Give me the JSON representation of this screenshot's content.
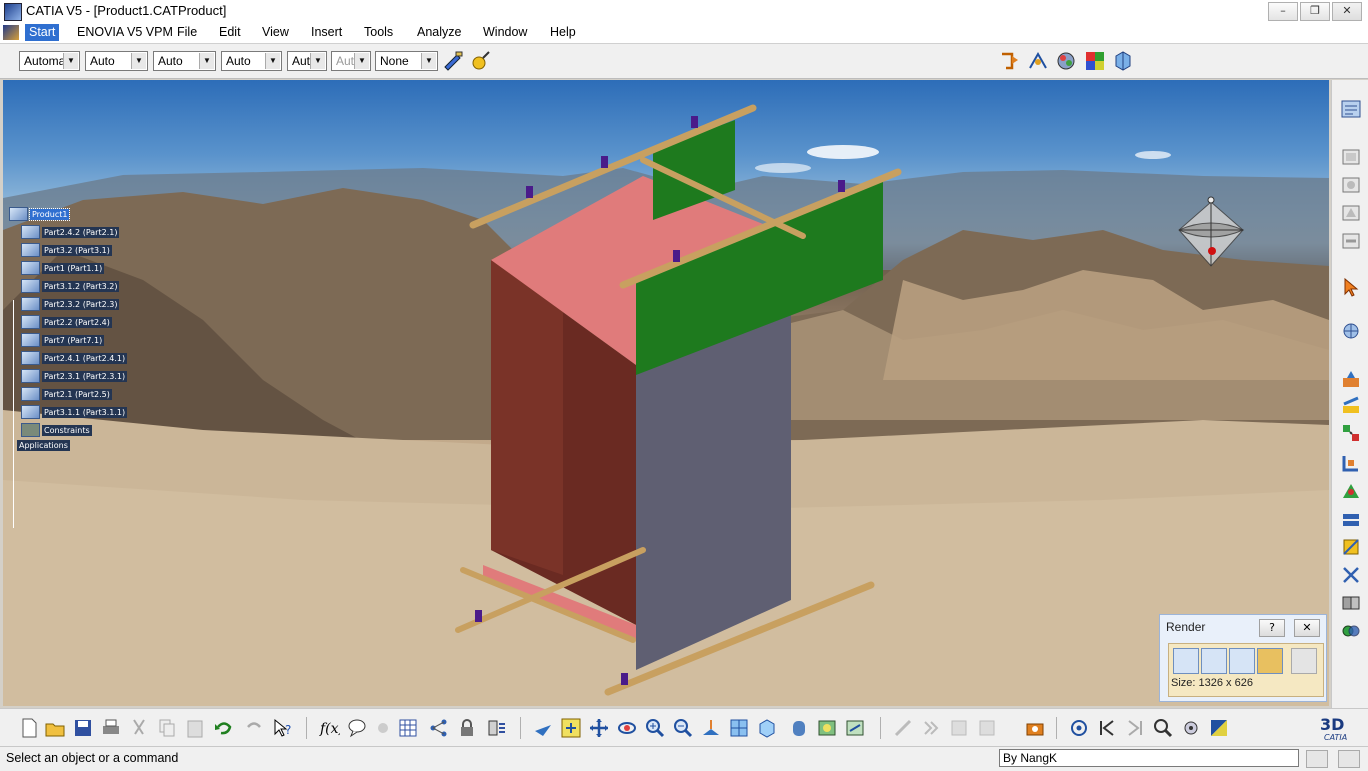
{
  "window": {
    "title": "CATIA V5 - [Product1.CATProduct]",
    "minimize": "–",
    "restore": "❐",
    "close": "✕"
  },
  "menu": {
    "items": [
      "Start",
      "ENOVIA V5 VPM",
      "File",
      "Edit",
      "View",
      "Insert",
      "Tools",
      "Analyze",
      "Window",
      "Help"
    ],
    "doc_minimize": "–",
    "doc_restore": "❐",
    "doc_close": "✕"
  },
  "toolbar": {
    "combos": [
      {
        "value": "Automa"
      },
      {
        "value": "Auto"
      },
      {
        "value": "Auto"
      },
      {
        "value": "Auto"
      },
      {
        "value": "Aut"
      },
      {
        "value": "Aut"
      },
      {
        "value": "None"
      }
    ],
    "combo_arrow": "▼"
  },
  "tree": {
    "root": "Product1",
    "nodes": [
      "Part2.4.2 (Part2.1)",
      "Part3.2 (Part3.1)",
      "Part1 (Part1.1)",
      "Part3.1.2 (Part3.2)",
      "Part2.3.2 (Part2.3)",
      "Part2.2 (Part2.4)",
      "Part7 (Part7.1)",
      "Part2.4.1 (Part2.4.1)",
      "Part2.3.1 (Part2.3.1)",
      "Part2.1 (Part2.5)",
      "Part3.1.1 (Part3.1.1)"
    ],
    "constraints": "Constraints",
    "applications": "Applications",
    "expander": "+"
  },
  "render_panel": {
    "title": "Render",
    "help": "?",
    "close": "✕",
    "size_text": "Size: 1326 x 626"
  },
  "status": {
    "message": "Select an object or a command",
    "command_input": "By NangK"
  },
  "icons": {
    "top_right": [
      "update-icon",
      "fly-mode-icon",
      "apply-material-icon",
      "scenes-icon",
      "catalog-icon"
    ],
    "right": [
      "tree-icon",
      "product-icon",
      "component-icon",
      "part-icon",
      "existing-component-icon",
      "select-icon",
      "manipulate-icon",
      "fix-icon",
      "snap-icon",
      "explode-icon",
      "constraint-icon",
      "coincidence-icon",
      "contact-icon",
      "offset-icon",
      "angle-icon",
      "fix-together-icon",
      "quick-constraint-icon"
    ],
    "bottom": [
      "new-icon",
      "open-icon",
      "save-icon",
      "print-icon",
      "cut-icon",
      "copy-icon",
      "paste-icon",
      "undo-icon",
      "redo-icon",
      "whats-this-icon",
      "formula-icon",
      "annotation-icon",
      "knowledge-icon",
      "table-icon",
      "graph-icon",
      "lock-icon",
      "measure-icon",
      "fly-icon",
      "fit-all-icon",
      "pan-icon",
      "rotate-icon",
      "zoom-in-icon",
      "zoom-out-icon",
      "normal-view-icon",
      "multi-view-icon",
      "isometric-icon",
      "shading-icon",
      "hide-show-icon",
      "swap-icon",
      "camera-icon",
      "target-icon",
      "first-icon",
      "next-icon",
      "search-icon",
      "settings-icon",
      "color-icon"
    ]
  },
  "colors": {
    "accent": "#2f6fd0",
    "tree_label_bg": "#243552",
    "render_bg": "#f5e8c2"
  }
}
